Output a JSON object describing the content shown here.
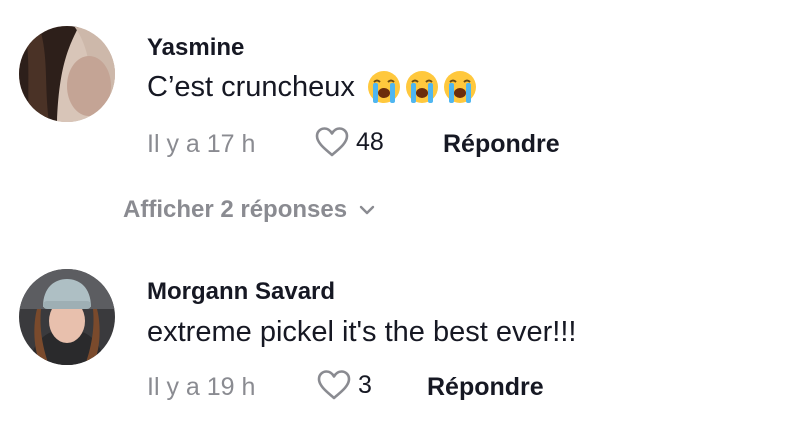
{
  "comments": [
    {
      "username": "Yasmine",
      "text": "C’est cruncheux",
      "emojis": [
        "loudly-crying-face",
        "loudly-crying-face",
        "loudly-crying-face"
      ],
      "timestamp": "Il y a 17 h",
      "likes": "48",
      "reply_label": "Répondre",
      "avatar_icon": "avatar-photo"
    },
    {
      "username": "Morgann Savard",
      "text": "extreme pickel it's the best ever!!!",
      "timestamp": "Il y a 19 h",
      "likes": "3",
      "reply_label": "Répondre",
      "avatar_icon": "avatar-photo"
    }
  ],
  "view_replies_label": "Afficher 2 réponses",
  "colors": {
    "text_primary": "#161823",
    "text_secondary": "#8a8b91",
    "emoji_face": "#ffc83d"
  }
}
